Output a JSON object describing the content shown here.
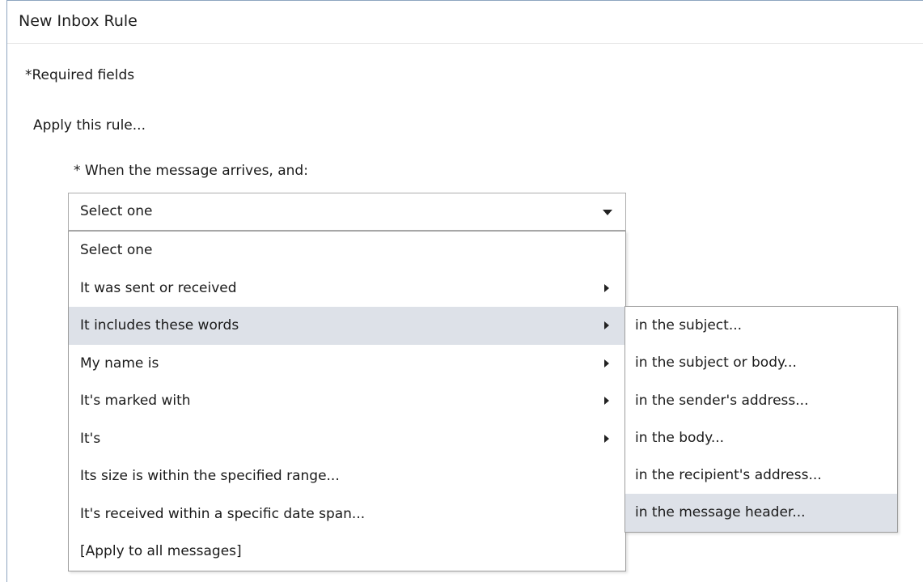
{
  "window": {
    "title": "New Inbox Rule"
  },
  "form": {
    "required_note": "*Required fields",
    "apply_label": "Apply this rule...",
    "when_label": "* When the message arrives, and:",
    "dropdown": {
      "selected": "Select one",
      "caret_icon": "chevron-down-icon"
    }
  },
  "menu": {
    "items": [
      {
        "label": "Select one",
        "has_submenu": false
      },
      {
        "label": "It was sent or received",
        "has_submenu": true
      },
      {
        "label": "It includes these words",
        "has_submenu": true,
        "highlighted": true
      },
      {
        "label": "My name is",
        "has_submenu": true
      },
      {
        "label": "It's marked with",
        "has_submenu": true
      },
      {
        "label": "It's",
        "has_submenu": true
      },
      {
        "label": "Its size is within the specified range...",
        "has_submenu": false
      },
      {
        "label": "It's received within a specific date span...",
        "has_submenu": false
      },
      {
        "label": "[Apply to all messages]",
        "has_submenu": false
      }
    ]
  },
  "submenu": {
    "items": [
      {
        "label": "in the subject..."
      },
      {
        "label": "in the subject or body..."
      },
      {
        "label": "in the sender's address..."
      },
      {
        "label": "in the body..."
      },
      {
        "label": "in the recipient's address..."
      },
      {
        "label": "in the message header...",
        "highlighted": true
      }
    ]
  },
  "colors": {
    "highlight": "#dde1e8",
    "border": "#9d9d9d",
    "window_border": "#8ea5c0"
  }
}
